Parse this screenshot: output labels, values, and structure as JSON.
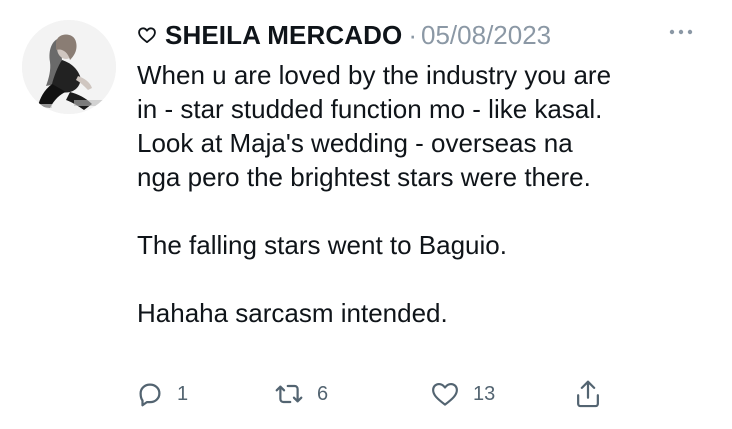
{
  "tweet": {
    "author": {
      "display_name": "SHEILA MERCADO",
      "name_prefix_icon": "heart-outline-icon"
    },
    "separator": "·",
    "date": "05/08/2023",
    "more_icon": "more-horizontal-icon",
    "text_lines": [
      "When u are loved by the industry you are",
      "in - star studded function mo - like kasal.",
      "Look at Maja's wedding - overseas na",
      "nga pero the brightest stars were there.",
      "",
      "The falling stars went to Baguio.",
      "",
      "Hahaha sarcasm intended."
    ],
    "actions": {
      "reply": {
        "icon": "reply-icon",
        "count": "1"
      },
      "retweet": {
        "icon": "retweet-icon",
        "count": "6"
      },
      "like": {
        "icon": "like-icon",
        "count": "13"
      },
      "share": {
        "icon": "share-icon"
      }
    }
  },
  "colors": {
    "text": "#0f1419",
    "muted": "#8b98a5",
    "icon": "#536471"
  }
}
